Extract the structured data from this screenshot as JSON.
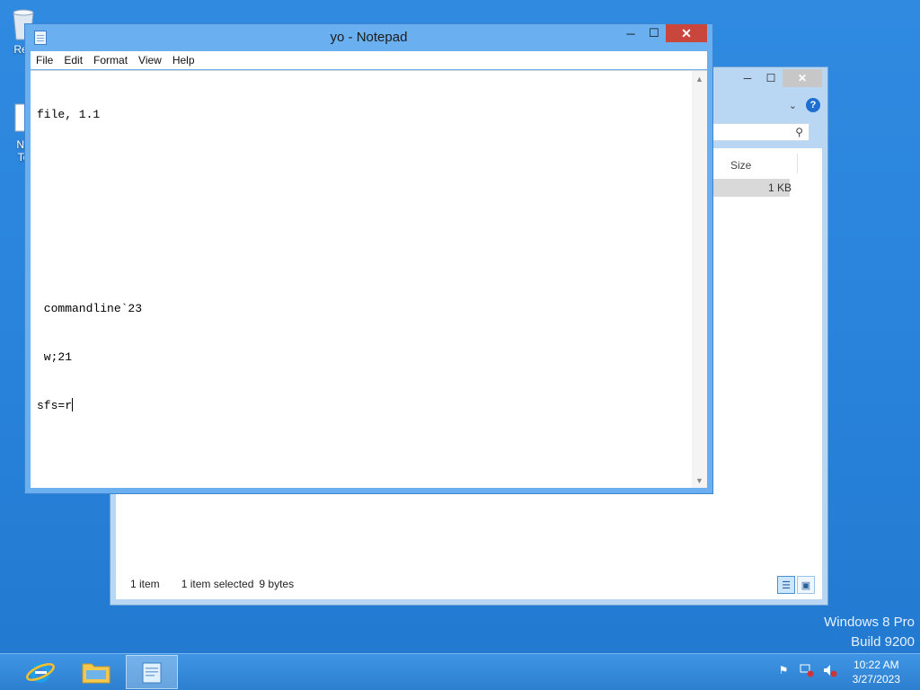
{
  "desktop": {
    "icons": [
      {
        "label": "Rec",
        "name": "recycle-bin"
      },
      {
        "label": "Ne\nTe",
        "name": "new-text-document"
      }
    ],
    "watermark": {
      "line1": "Windows 8 Pro",
      "line2": "Build 9200"
    }
  },
  "explorer": {
    "controls": {
      "minimize": "─",
      "maximize": "☐",
      "close": "✕"
    },
    "help": "?",
    "search_icon": "⚲",
    "column_size": "Size",
    "row_size": "1 KB",
    "status": {
      "items": "1 item",
      "selected": "1 item selected",
      "bytes": "9 bytes"
    }
  },
  "notepad": {
    "title": "yo - Notepad",
    "controls": {
      "minimize": "─",
      "maximize": "☐",
      "close": "✕"
    },
    "menu": [
      "File",
      "Edit",
      "Format",
      "View",
      "Help"
    ],
    "lines": [
      "file, 1.1",
      "",
      "",
      "",
      " commandline`23",
      " w;21",
      "sfs=r"
    ]
  },
  "taskbar": {
    "apps": [
      "internet-explorer",
      "file-explorer",
      "notepad"
    ],
    "clock": {
      "time": "10:22 AM",
      "date": "3/27/2023"
    }
  }
}
